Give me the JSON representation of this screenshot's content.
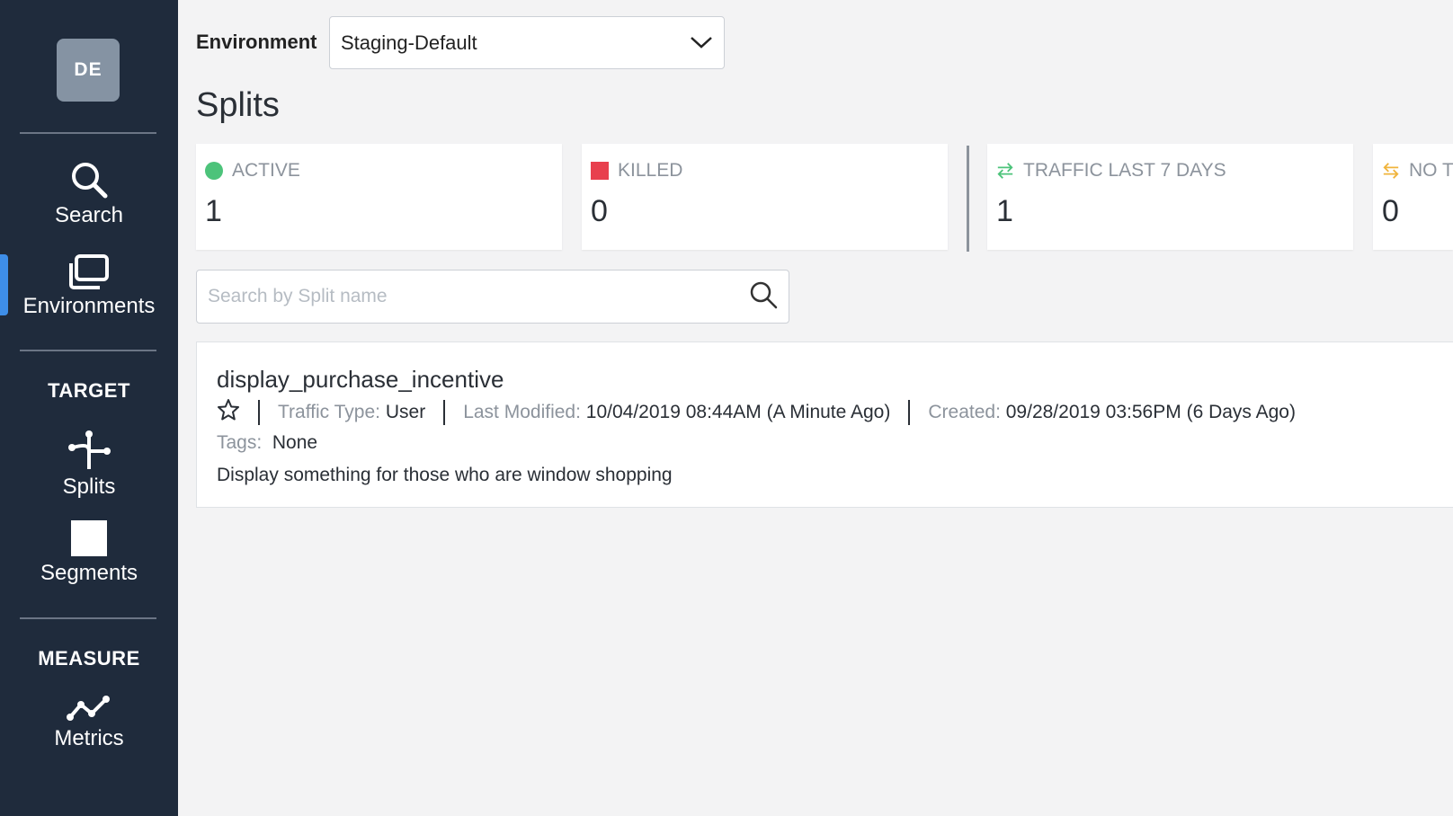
{
  "sidebar": {
    "avatar_initials": "DE",
    "items": [
      {
        "label": "Search",
        "icon": "search-icon"
      },
      {
        "label": "Environments",
        "icon": "environments-icon"
      }
    ],
    "target_heading": "TARGET",
    "target_items": [
      {
        "label": "Splits",
        "icon": "splits-icon"
      },
      {
        "label": "Segments",
        "icon": "segments-icon"
      }
    ],
    "measure_heading": "MEASURE",
    "measure_items": [
      {
        "label": "Metrics",
        "icon": "metrics-icon"
      }
    ],
    "active_accent": "#3e8ee8"
  },
  "environment": {
    "label": "Environment",
    "selected": "Staging-Default"
  },
  "page_title": "Splits",
  "stats": [
    {
      "label": "ACTIVE",
      "value": "1",
      "icon": "green-dot-icon",
      "color": "#4cc37a"
    },
    {
      "label": "KILLED",
      "value": "0",
      "icon": "red-square-icon",
      "color": "#e8404e"
    },
    {
      "label": "TRAFFIC LAST 7 DAYS",
      "value": "1",
      "icon": "traffic-arrows-icon",
      "color": "#4cc37a"
    },
    {
      "label": "NO T",
      "value": "0",
      "icon": "no-traffic-arrows-icon",
      "color": "#f0b43c"
    }
  ],
  "search": {
    "placeholder": "Search by Split name"
  },
  "split": {
    "name": "display_purchase_incentive",
    "traffic_type_label": "Traffic Type:",
    "traffic_type_value": "User",
    "last_modified_label": "Last Modified:",
    "last_modified_value": "10/04/2019 08:44AM (A Minute Ago)",
    "created_label": "Created:",
    "created_value": "09/28/2019 03:56PM (6 Days Ago)",
    "tags_label": "Tags:",
    "tags_value": "None",
    "description": "Display something for those who are window shopping"
  }
}
